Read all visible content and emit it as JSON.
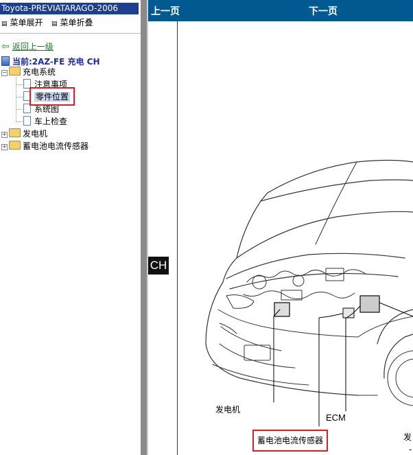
{
  "window": {
    "title": "Toyota-PREVIATARAGO-2006"
  },
  "menu": {
    "expand_label": "菜单展开",
    "collapse_label": "菜单折叠"
  },
  "nav": {
    "back_label": "返回上一级",
    "current_label": "当前:2AZ-FE 充电  CH"
  },
  "tree": {
    "root": {
      "label": "充电系统"
    },
    "children": [
      {
        "label": "注意事项"
      },
      {
        "label": "零件位置"
      },
      {
        "label": "系统图"
      },
      {
        "label": "车上检查"
      }
    ],
    "siblings": [
      {
        "label": "发电机"
      },
      {
        "label": "蓄电池电流传感器"
      }
    ]
  },
  "viewer": {
    "prev_label": "上一页",
    "next_label": "下一页",
    "section_tab": "CH",
    "callouts": {
      "generator": "发电机",
      "ecm": "ECM",
      "battery_sensor": "蓄电池电流传感器",
      "partial_right": "发",
      "partial_right2": "- A"
    }
  },
  "colors": {
    "title_bar": "#1d3f8e",
    "nav_bar": "#005a92",
    "highlight_red": "#e11b22",
    "link_green": "#1a7a1a",
    "current_blue": "#1a2aa8"
  }
}
